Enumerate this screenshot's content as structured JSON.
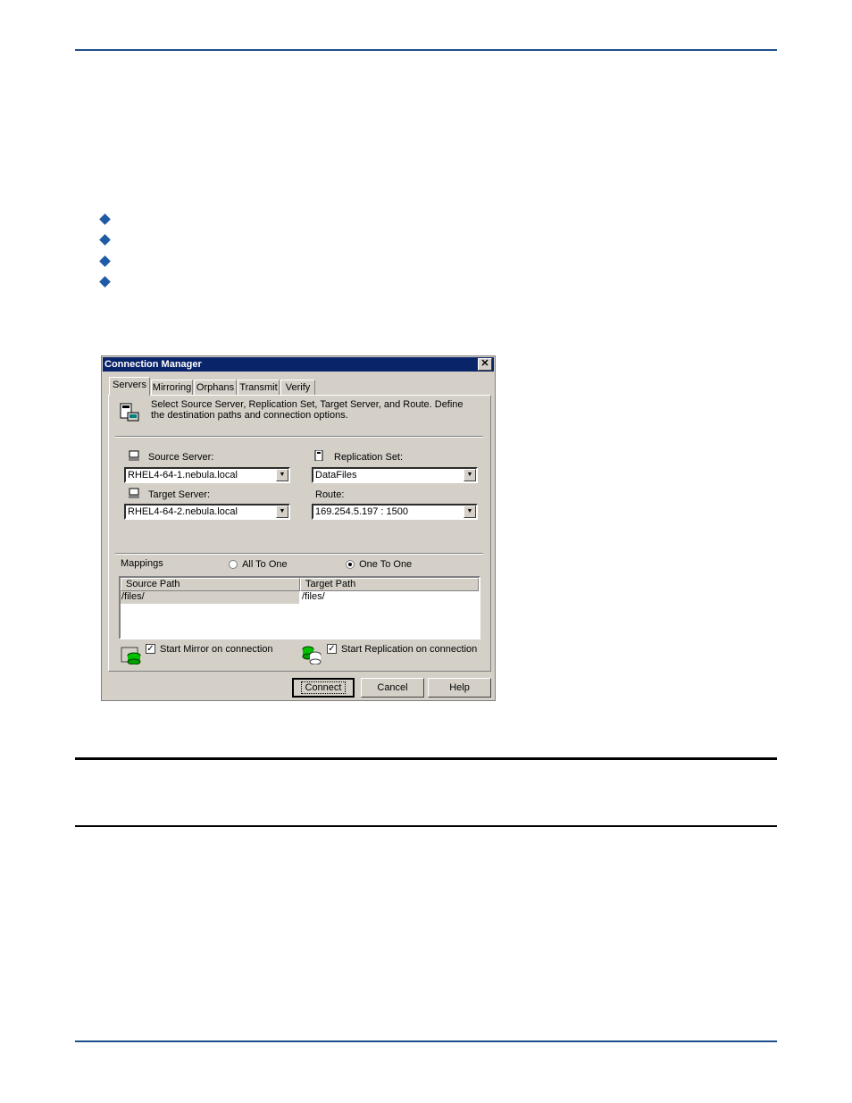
{
  "dialog": {
    "title": "Connection Manager",
    "close_glyph": "✕",
    "tabs": [
      "Servers",
      "Mirroring",
      "Orphans",
      "Transmit",
      "Verify"
    ],
    "description": "Select Source Server, Replication Set, Target Server, and Route.  Define the destination paths and connection options.",
    "source_server_label": "Source Server:",
    "source_server_value": "RHEL4-64-1.nebula.local",
    "replication_set_label": "Replication Set:",
    "replication_set_value": "DataFiles",
    "target_server_label": "Target Server:",
    "target_server_value": "RHEL4-64-2.nebula.local",
    "route_label": "Route:",
    "route_value": "169.254.5.197 : 1500",
    "mappings_label": "Mappings",
    "radio_all_to_one": "All To One",
    "radio_one_to_one": "One To One",
    "columns": [
      "Source Path",
      "Target Path"
    ],
    "rows": [
      [
        "/files/",
        "/files/"
      ]
    ],
    "start_mirror_label": "Start Mirror on connection",
    "start_replication_label": "Start Replication on connection",
    "check_glyph": "✓",
    "buttons": {
      "connect": "Connect",
      "cancel": "Cancel",
      "help": "Help"
    },
    "icons": [
      "servers-icon",
      "source-server-icon",
      "replication-set-icon",
      "target-server-icon",
      "mirror-icon",
      "replication-icon"
    ]
  }
}
